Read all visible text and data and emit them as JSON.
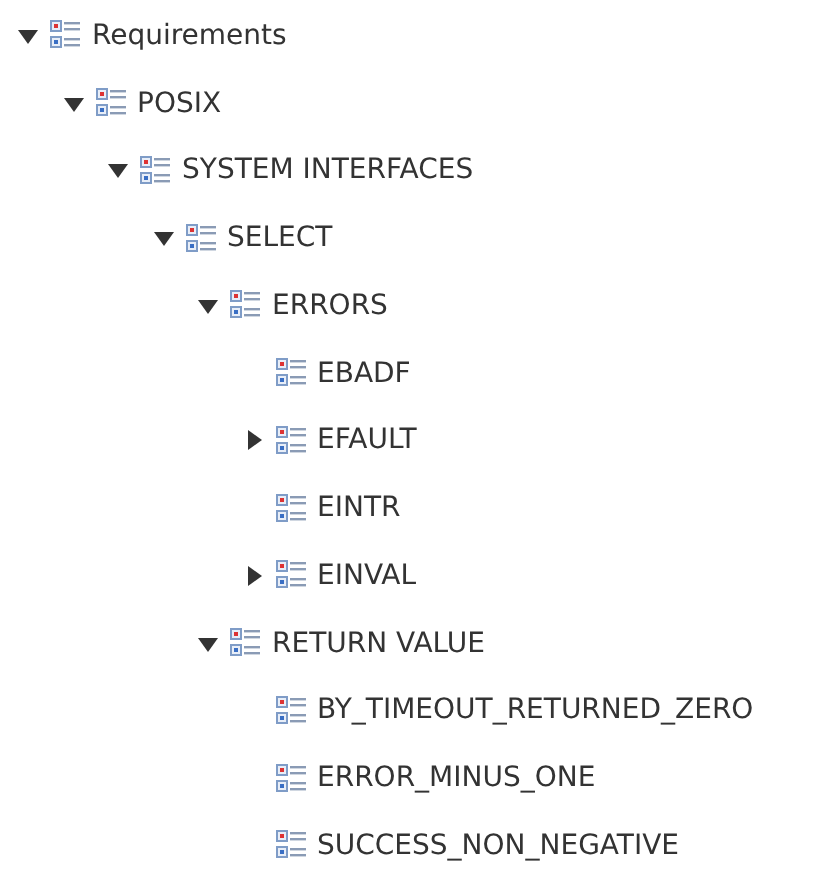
{
  "tree": [
    {
      "label": "Requirements",
      "kind": "branch",
      "expanded": true,
      "children": [
        {
          "label": "POSIX",
          "kind": "branch",
          "expanded": true,
          "children": [
            {
              "label": "SYSTEM INTERFACES",
              "kind": "branch",
              "expanded": true,
              "children": [
                {
                  "label": "SELECT",
                  "kind": "branch",
                  "expanded": true,
                  "children": [
                    {
                      "label": "ERRORS",
                      "kind": "branch",
                      "expanded": true,
                      "children": [
                        {
                          "label": "EBADF",
                          "kind": "leaf"
                        },
                        {
                          "label": "EFAULT",
                          "kind": "branch",
                          "expanded": false
                        },
                        {
                          "label": "EINTR",
                          "kind": "leaf"
                        },
                        {
                          "label": "EINVAL",
                          "kind": "branch",
                          "expanded": false
                        }
                      ]
                    },
                    {
                      "label": "RETURN VALUE",
                      "kind": "branch",
                      "expanded": true,
                      "children": [
                        {
                          "label": "BY_TIMEOUT_RETURNED_ZERO",
                          "kind": "leaf"
                        },
                        {
                          "label": "ERROR_MINUS_ONE",
                          "kind": "leaf"
                        },
                        {
                          "label": "SUCCESS_NON_NEGATIVE",
                          "kind": "leaf"
                        }
                      ]
                    }
                  ]
                }
              ]
            }
          ]
        }
      ]
    }
  ]
}
